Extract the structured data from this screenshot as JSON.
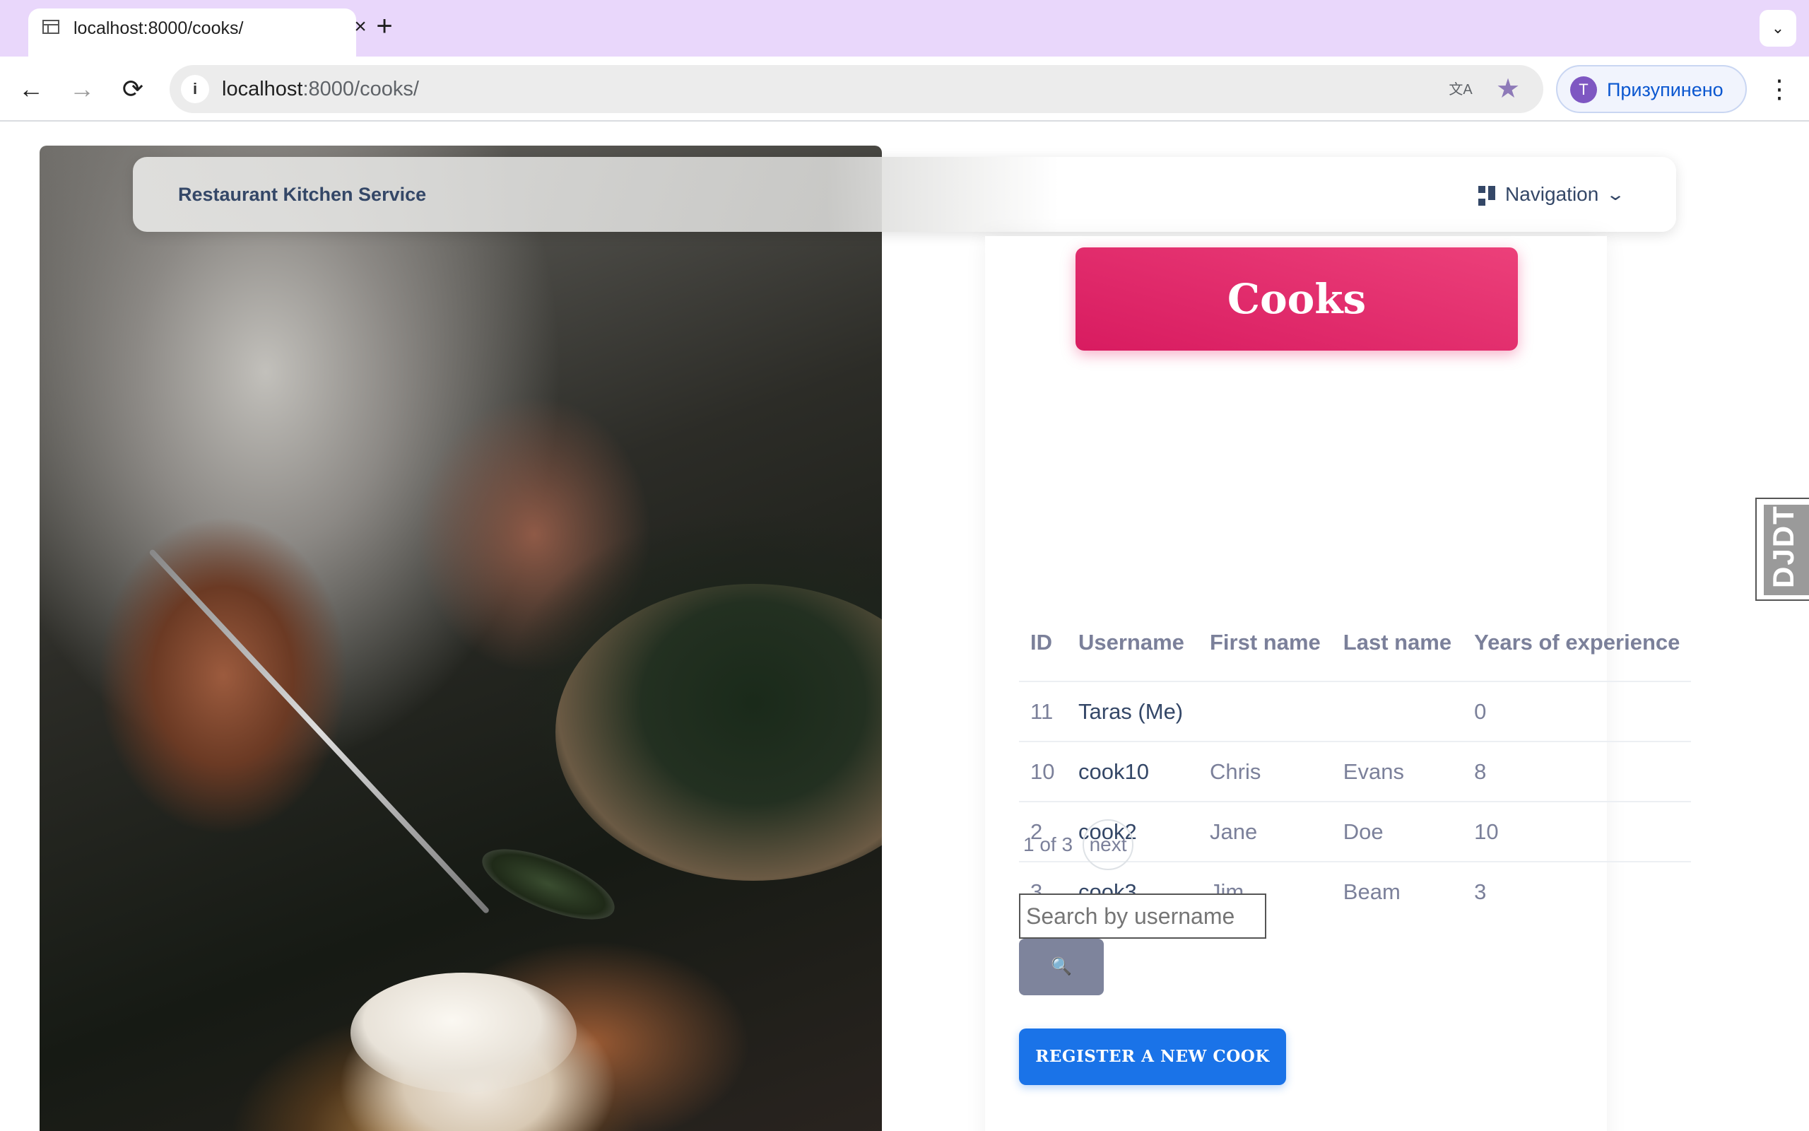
{
  "browser": {
    "tab_title": "localhost:8000/cooks/",
    "tab_close": "×",
    "new_tab": "+",
    "tab_menu": "⌄",
    "url_host": "localhost",
    "url_path": ":8000/cooks/",
    "info": "i",
    "translate": "文A",
    "star": "★",
    "profile_initial": "T",
    "profile_label": "Призупинено",
    "back": "←",
    "forward": "→",
    "reload": "⟳",
    "menu": "⋮"
  },
  "navbar": {
    "brand": "Restaurant Kitchen Service",
    "nav_label": "Navigation",
    "chevron": "⌄"
  },
  "main": {
    "heading": "Cooks",
    "table": {
      "headers": [
        "ID",
        "Username",
        "First name",
        "Last name",
        "Years of experience"
      ],
      "rows": [
        {
          "id": "11",
          "username": "Taras (Me)",
          "first_name": "",
          "last_name": "",
          "years": "0"
        },
        {
          "id": "10",
          "username": "cook10",
          "first_name": "Chris",
          "last_name": "Evans",
          "years": "8"
        },
        {
          "id": "2",
          "username": "cook2",
          "first_name": "Jane",
          "last_name": "Doe",
          "years": "10"
        },
        {
          "id": "3",
          "username": "cook3",
          "first_name": "Jim",
          "last_name": "Beam",
          "years": "3"
        }
      ]
    },
    "pagination": {
      "info": "1 of 3",
      "next": "next"
    },
    "search": {
      "placeholder": "Search by username",
      "button": "🔍"
    },
    "register_button": "REGISTER A NEW COOK"
  },
  "debug_toolbar": {
    "label": "DJDT"
  },
  "colors": {
    "tab_strip": "#e9d7fb",
    "banner_start": "#ec407a",
    "banner_end": "#d81b60",
    "register_button": "#1a73e8",
    "search_button": "#7e849c",
    "text_dark": "#344767",
    "text_muted": "#7b809a"
  },
  "icons": {
    "favicon": "table-favicon-icon",
    "nav": "dashboard-icon"
  }
}
